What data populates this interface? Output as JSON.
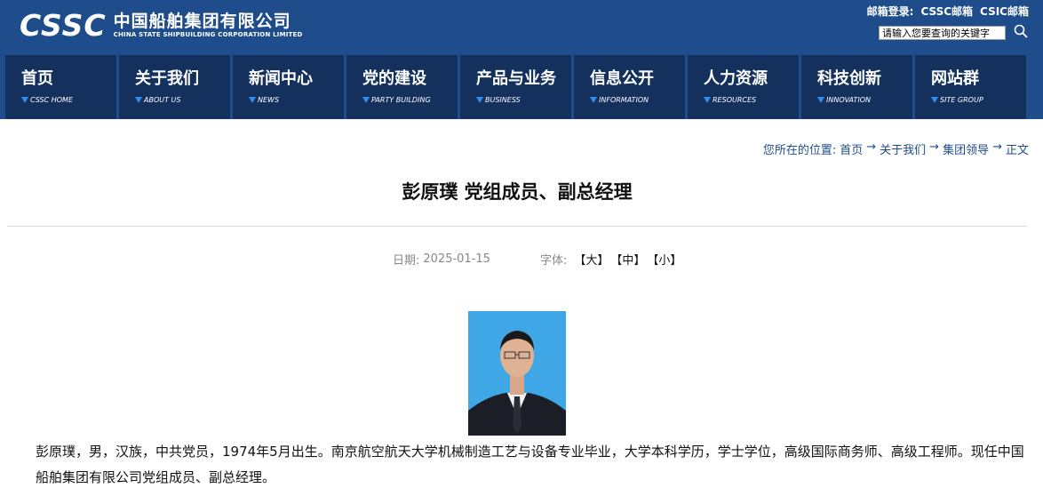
{
  "header": {
    "logo_en": "CSSC",
    "logo_cn": "中国船舶集团有限公司",
    "logo_sub": "CHINA STATE SHIPBUILDING CORPORATION LIMITED",
    "mail_label": "邮箱登录:",
    "mail_links": [
      "CSSC邮箱",
      "CSIC邮箱"
    ],
    "search_placeholder": "请输入您要查询的关键字",
    "background_color": "#1f4d8c",
    "nav_color": "#13315c"
  },
  "nav": {
    "items": [
      {
        "cn": "首页",
        "en": "CSSC HOME"
      },
      {
        "cn": "关于我们",
        "en": "ABOUT US"
      },
      {
        "cn": "新闻中心",
        "en": "NEWS"
      },
      {
        "cn": "党的建设",
        "en": "PARTY BUILDING"
      },
      {
        "cn": "产品与业务",
        "en": "BUSINESS"
      },
      {
        "cn": "信息公开",
        "en": "INFORMATION"
      },
      {
        "cn": "人力资源",
        "en": "RESOURCES"
      },
      {
        "cn": "科技创新",
        "en": "INNOVATION"
      },
      {
        "cn": "网站群",
        "en": "SITE GROUP"
      }
    ]
  },
  "breadcrumb": {
    "label": "您所在的位置:",
    "items": [
      "首页",
      "关于我们",
      "集团领导",
      "正文"
    ],
    "separator": "→"
  },
  "article": {
    "title": "彭原璞 党组成员、副总经理",
    "date_label": "日期:",
    "date": "2025-01-15",
    "font_label": "字体:",
    "font_options": [
      "【大】",
      "【中】",
      "【小】"
    ],
    "paragraph": "彭原璞，男，汉族，中共党员，1974年5月出生。南京航空航天大学机械制造工艺与设备专业毕业，大学本科学历，学士学位，高级国际商务师、高级工程师。现任中国船舶集团有限公司党组成员、副总经理。"
  }
}
